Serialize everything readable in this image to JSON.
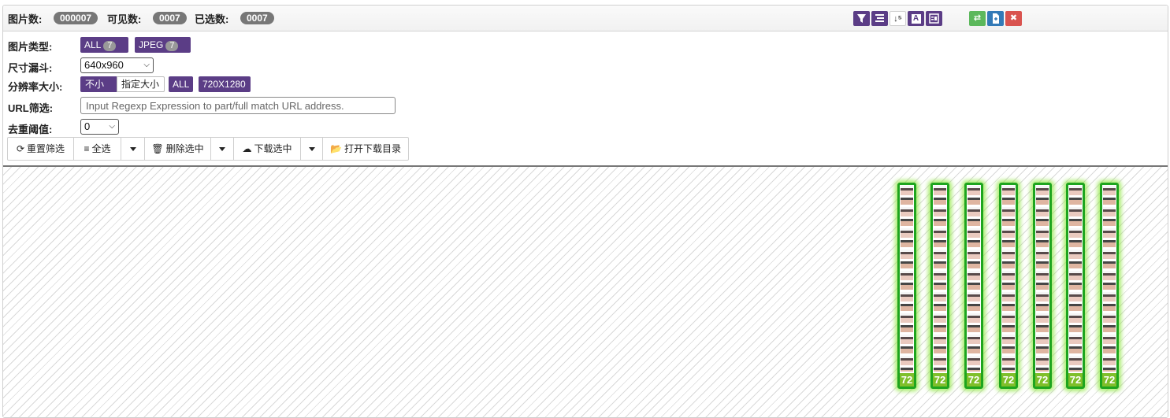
{
  "stats": {
    "total_label": "图片数:",
    "total_value": "000007",
    "visible_label": "可见数:",
    "visible_value": "0007",
    "selected_label": "已选数:",
    "selected_value": "0007"
  },
  "toolbar": {
    "icons": [
      "filter-icon",
      "align-icon",
      "sort-icon",
      "text-icon",
      "view-icon"
    ],
    "sort_glyph": "↓⁵",
    "text_glyph": "A",
    "action_icons": [
      "swap-icon",
      "export-icon",
      "close-icon"
    ],
    "swap_glyph": "⇄",
    "close_glyph": "✖"
  },
  "filters": {
    "type_label": "图片类型:",
    "type_all": "ALL",
    "type_all_count": "7",
    "type_jpeg": "JPEG",
    "type_jpeg_count": "7",
    "size_label": "尺寸漏斗:",
    "size_value": "640x960",
    "resolution_label": "分辨率大小:",
    "resolution_mode_active": "不小于",
    "resolution_mode_other": "指定大小",
    "resolution_all": "ALL",
    "resolution_value": "720X1280",
    "url_label": "URL筛选:",
    "url_placeholder": "Input Regexp Expression to part/full match URL address.",
    "dedup_label": "去重阈值:",
    "dedup_value": "0"
  },
  "actions": {
    "reset": "重置筛选",
    "select_all": "全选",
    "delete": "删除选中",
    "download": "下载选中",
    "open_dir": "打开下载目录"
  },
  "images": [
    {
      "label": "72"
    },
    {
      "label": "72"
    },
    {
      "label": "72"
    },
    {
      "label": "72"
    },
    {
      "label": "72"
    },
    {
      "label": "72"
    },
    {
      "label": "72"
    }
  ],
  "colors": {
    "primary": "#5b3d86",
    "badge": "#777777",
    "selected_border": "#1ea51e",
    "resolution_tag": "#7fbf2a",
    "success": "#5cb85c",
    "info": "#337ab7",
    "danger": "#d9534f"
  }
}
